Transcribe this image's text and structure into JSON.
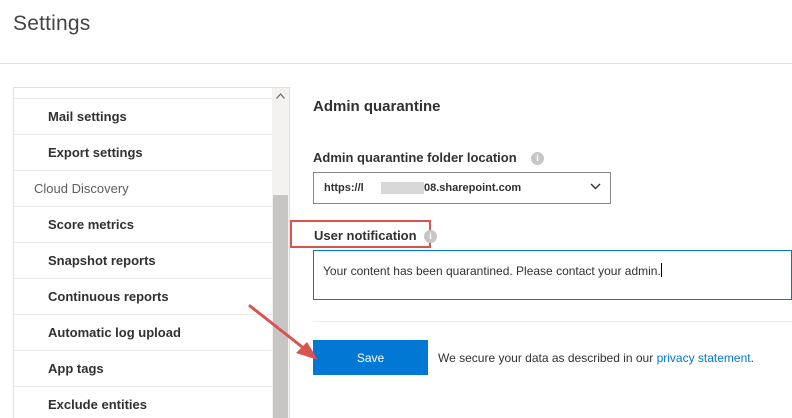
{
  "page": {
    "title": "Settings"
  },
  "sidebar": {
    "items": [
      {
        "label": "Mail settings",
        "kind": "sub"
      },
      {
        "label": "Export settings",
        "kind": "sub"
      },
      {
        "label": "Cloud Discovery",
        "kind": "group"
      },
      {
        "label": "Score metrics",
        "kind": "sub"
      },
      {
        "label": "Snapshot reports",
        "kind": "sub"
      },
      {
        "label": "Continuous reports",
        "kind": "sub"
      },
      {
        "label": "Automatic log upload",
        "kind": "sub"
      },
      {
        "label": "App tags",
        "kind": "sub"
      },
      {
        "label": "Exclude entities",
        "kind": "sub"
      }
    ]
  },
  "main": {
    "section_title": "Admin quarantine",
    "folder_label": "Admin quarantine folder location",
    "folder_value_prefix": "https://l",
    "folder_value_suffix": "08.sharepoint.com",
    "notification_label": "User notification",
    "notification_value": "Your content has been quarantined. Please contact your admin.",
    "save_label": "Save",
    "privacy_prefix": "We secure your data as described in our ",
    "privacy_link": "privacy statement",
    "privacy_suffix": "."
  },
  "icons": {
    "info": "info-icon",
    "chevron": "chevron-down-icon",
    "scroll_up": "scroll-up-arrow-icon"
  },
  "colors": {
    "accent": "#0078d4",
    "annotation": "#d9534f"
  }
}
